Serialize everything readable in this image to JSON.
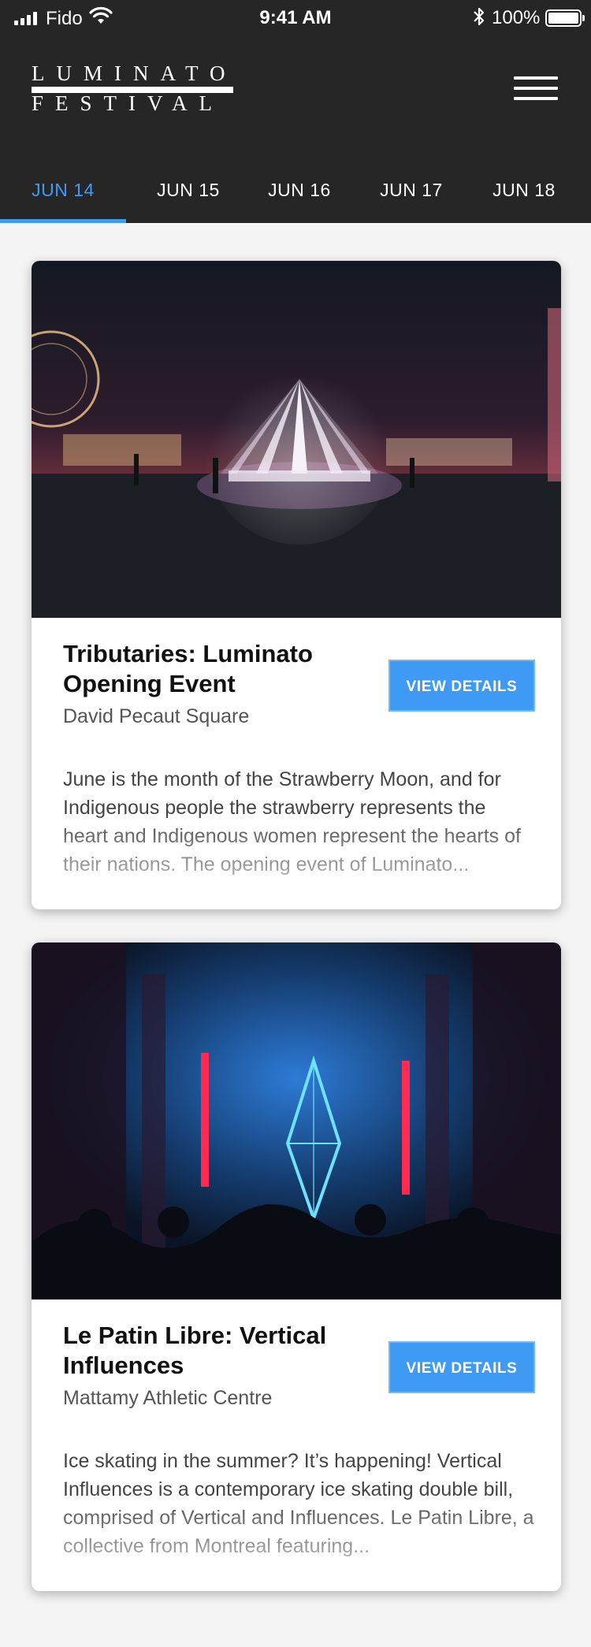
{
  "status_bar": {
    "carrier": "Fido",
    "time": "9:41 AM",
    "battery": "100%"
  },
  "header": {
    "logo_line1": "LUMINATO",
    "logo_line2": "FESTIVAL",
    "menu_icon": "hamburger-menu-icon"
  },
  "tabs": [
    {
      "label": "JUN 14",
      "active": true
    },
    {
      "label": "JUN 15",
      "active": false
    },
    {
      "label": "JUN 16",
      "active": false
    },
    {
      "label": "JUN 17",
      "active": false
    },
    {
      "label": "JUN 18",
      "active": false
    }
  ],
  "events": [
    {
      "title": "Tributaries: Luminato Opening Event",
      "venue": "David Pecaut Square",
      "button_label": "VIEW DETAILS",
      "description": "June is the month of the Strawberry Moon, and for Indigenous people the strawberry represents the heart and Indigenous women represent the hearts of their nations. The opening event of Luminato..."
    },
    {
      "title": "Le Patin Libre: Vertical Influences",
      "venue": "Mattamy Athletic Centre",
      "button_label": "VIEW DETAILS",
      "description": "Ice skating in the summer? It’s happening! Vertical Influences is a contemporary ice skating double bill, comprised of Vertical and Influences. Le Patin Libre, a collective from Montreal featuring..."
    }
  ],
  "colors": {
    "accent": "#3f9af4",
    "header_bg": "#262626",
    "page_bg": "#f4f4f4"
  }
}
